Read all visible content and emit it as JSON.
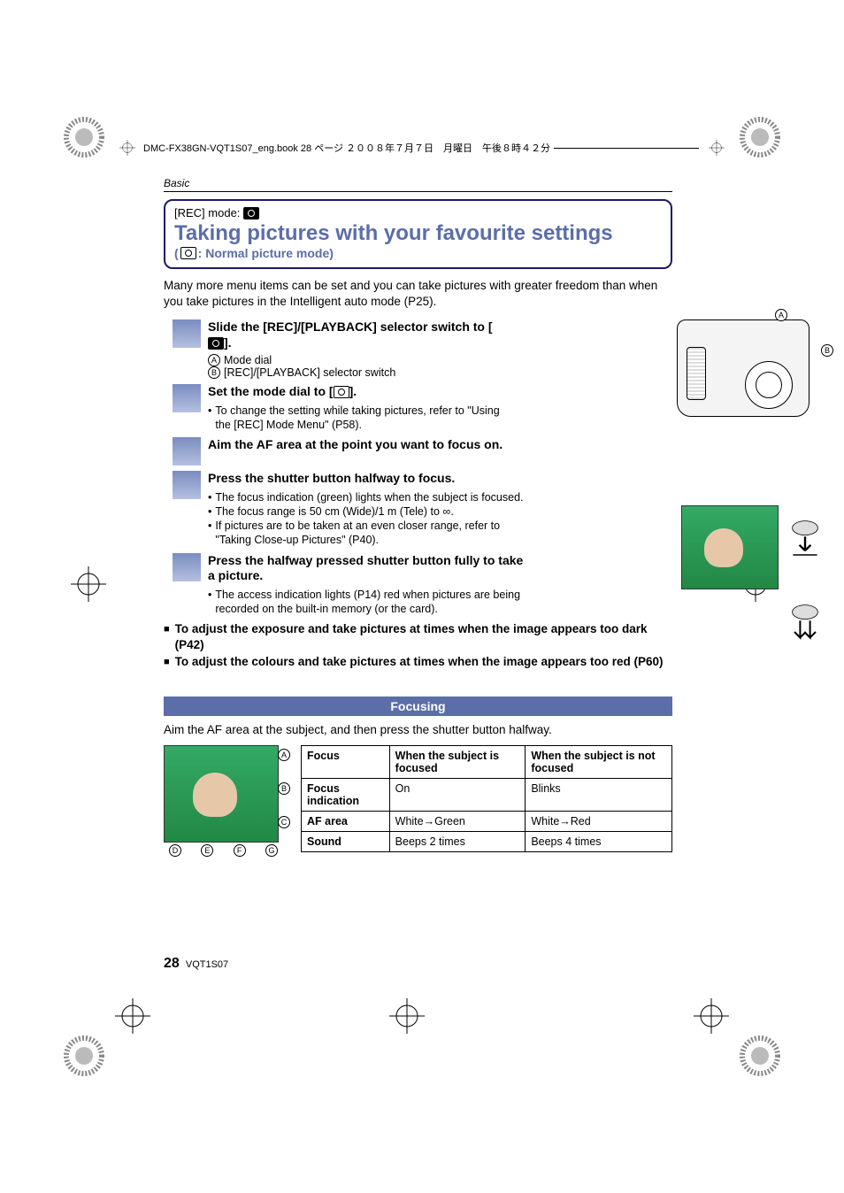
{
  "header": {
    "running": "DMC-FX38GN-VQT1S07_eng.book  28 ページ  ２００８年７月７日　月曜日　午後８時４２分"
  },
  "section_label": "Basic",
  "title_box": {
    "rec_mode_label": "[REC] mode:",
    "main_title": "Taking pictures with your favourite settings",
    "sub_title_prefix": "(",
    "sub_title_suffix": ": Normal picture mode)"
  },
  "intro": "Many more menu items can be set and you can take pictures with greater freedom than when you take pictures in the Intelligent auto mode (P25).",
  "steps": {
    "s1": {
      "title_a": "Slide the [REC]/[PLAYBACK] selector switch to [",
      "title_b": "].",
      "label_a": "Mode dial",
      "label_b": "[REC]/[PLAYBACK] selector switch"
    },
    "s2": {
      "title_a": "Set the mode dial to [",
      "title_b": "].",
      "bullet1": "To change the setting while taking pictures, refer to \"Using the [REC] Mode Menu\" (P58)."
    },
    "s3": {
      "title": "Aim the AF area at the point you want to focus on."
    },
    "s4": {
      "title": "Press the shutter button halfway to focus.",
      "b1": "The focus indication (green) lights when the subject is focused.",
      "b2": "The focus range is 50 cm (Wide)/1 m (Tele) to ∞.",
      "b3": "If pictures are to be taken at an even closer range, refer to \"Taking Close-up Pictures\" (P40)."
    },
    "s5": {
      "title": "Press the halfway pressed shutter button fully to take a picture.",
      "b1": "The access indication lights (P14) red when pictures are being recorded on the built-in memory (or the card)."
    }
  },
  "notes": {
    "n1": "To adjust the exposure and take pictures at times when the image appears too dark (P42)",
    "n2": "To adjust the colours and take pictures at times when the image appears too red (P60)"
  },
  "focusing": {
    "heading": "Focusing",
    "intro": "Aim the AF area at the subject, and then press the shutter button halfway.",
    "labels": {
      "a": "A",
      "b": "B",
      "c": "C",
      "d": "D",
      "e": "E",
      "f": "F",
      "g": "G"
    },
    "table": {
      "h1": "Focus",
      "h2": "When the subject is focused",
      "h3": "When the subject is not focused",
      "r1c1": "Focus indication",
      "r1c2": "On",
      "r1c3": "Blinks",
      "r2c1": "AF area",
      "r2c2": "White→Green",
      "r2c3": "White→Red",
      "r3c1": "Sound",
      "r3c2": "Beeps 2 times",
      "r3c3": "Beeps 4 times"
    }
  },
  "footer": {
    "page": "28",
    "code": "VQT1S07"
  },
  "diagram_labels": {
    "a": "A",
    "b": "B"
  }
}
